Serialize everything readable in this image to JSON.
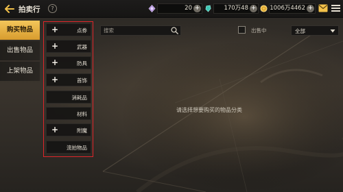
{
  "header": {
    "title": "拍卖行",
    "help": "?"
  },
  "currencies": [
    {
      "value": "20",
      "icon": "gem-purple-icon",
      "plus": "+"
    },
    {
      "value": "170万48",
      "icon": "crystal-teal-icon",
      "plus": "+"
    },
    {
      "value": "1006万4462",
      "icon": "gold-coin-icon",
      "plus": "+"
    }
  ],
  "tabs": [
    {
      "label": "购买物品",
      "active": true
    },
    {
      "label": "出售物品",
      "active": false
    },
    {
      "label": "上架物品",
      "active": false
    }
  ],
  "categories": [
    {
      "label": "点券",
      "expandable": true
    },
    {
      "label": "武器",
      "expandable": true
    },
    {
      "label": "防具",
      "expandable": true
    },
    {
      "label": "首饰",
      "expandable": true
    },
    {
      "label": "消耗品",
      "expandable": false
    },
    {
      "label": "材料",
      "expandable": false
    },
    {
      "label": "附魔",
      "expandable": true
    },
    {
      "label": "流拍物品",
      "expandable": false
    }
  ],
  "search": {
    "placeholder": "搜索",
    "value": ""
  },
  "filter": {
    "on_sale_label": "出售中",
    "on_sale_checked": false
  },
  "sort": {
    "selected": "全部"
  },
  "main": {
    "prompt": "请选择想要购买的物品分类"
  },
  "colors": {
    "tab_active": "#e8b447",
    "highlight_border": "#e0252a",
    "gold": "#f2c14a"
  }
}
